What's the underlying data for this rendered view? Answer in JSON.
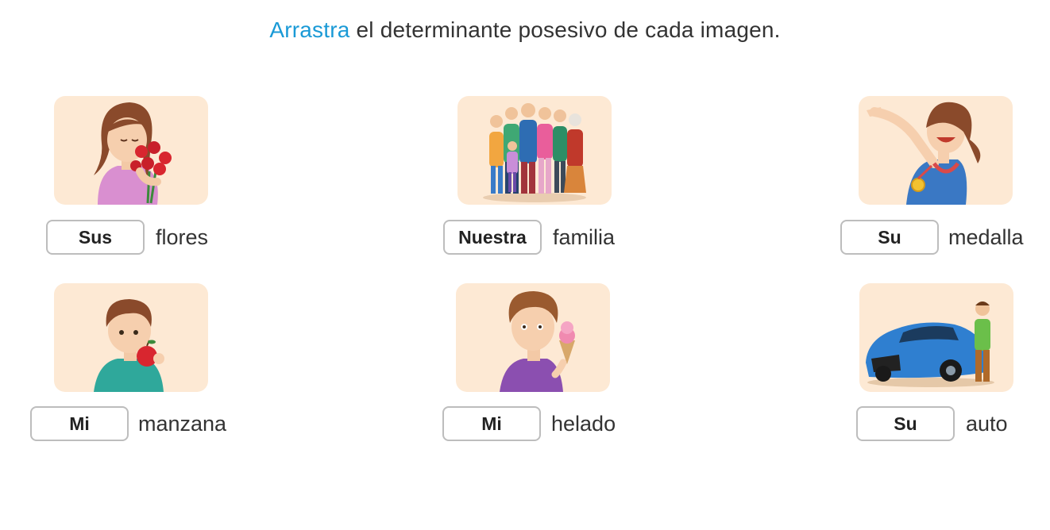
{
  "instruction": {
    "highlight": "Arrastra",
    "rest": " el determinante posesivo de cada imagen."
  },
  "colors": {
    "accent": "#1a9ad6",
    "card_bg": "#fde9d4",
    "slot_border": "#bdbdbd",
    "text": "#333333"
  },
  "items": [
    {
      "answer": "Sus",
      "noun": "flores",
      "image": "girl-smelling-roses"
    },
    {
      "answer": "Nuestra",
      "noun": "familia",
      "image": "family-group"
    },
    {
      "answer": "Su",
      "noun": "medalla",
      "image": "girl-with-medal"
    },
    {
      "answer": "Mi",
      "noun": "manzana",
      "image": "boy-with-apple"
    },
    {
      "answer": "Mi",
      "noun": "helado",
      "image": "boy-with-ice-cream"
    },
    {
      "answer": "Su",
      "noun": "auto",
      "image": "man-with-car"
    }
  ]
}
